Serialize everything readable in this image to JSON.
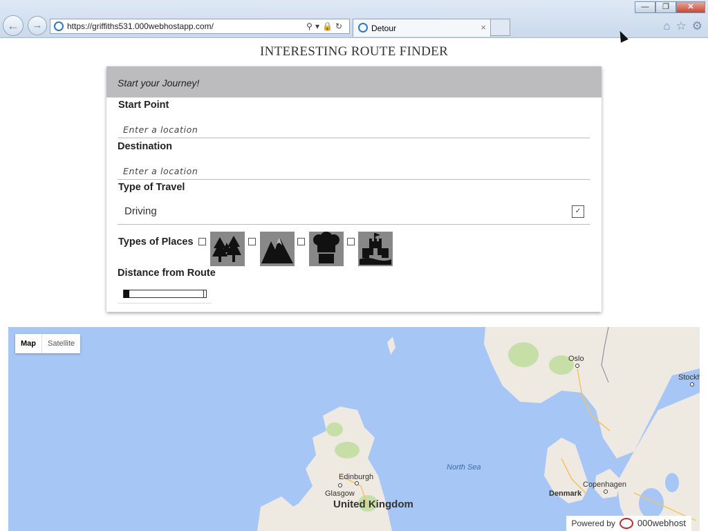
{
  "browser": {
    "url": "https://griffiths531.000webhostapp.com/",
    "tab_title": "Detour",
    "tab_close": "×",
    "back_icon": "back-arrow-icon",
    "forward_icon": "forward-arrow-icon",
    "window_buttons": [
      "minimize",
      "restore",
      "close"
    ]
  },
  "page": {
    "title": "INTERESTING ROUTE FINDER"
  },
  "form": {
    "header": "Start your Journey!",
    "start_label": "Start Point",
    "start_placeholder": "Enter a location",
    "destination_label": "Destination",
    "destination_placeholder": "Enter a location",
    "travel_label": "Type of Travel",
    "travel_value": "Driving",
    "places_label": "Types of Places",
    "places": [
      {
        "icon": "forest-icon",
        "checked": false
      },
      {
        "icon": "mountain-icon",
        "checked": false
      },
      {
        "icon": "restaurant-icon",
        "checked": false
      },
      {
        "icon": "castle-icon",
        "checked": false
      }
    ],
    "distance_label": "Distance from Route",
    "distance_value": 0
  },
  "map": {
    "type_map": "Map",
    "type_satellite": "Satellite",
    "labels": {
      "oslo": "Oslo",
      "stockholm": "Stockh",
      "north_sea": "North Sea",
      "edinburgh": "Edinburgh",
      "glasgow": "Glasgow",
      "uk": "United Kingdom",
      "denmark": "Denmark",
      "copenhagen": "Copenhagen"
    },
    "powered_by": "Powered by",
    "brand": "000webhost",
    "colors": {
      "water": "#a6c7f6",
      "land": "#eeeae2",
      "park": "#c6dfa6"
    }
  }
}
